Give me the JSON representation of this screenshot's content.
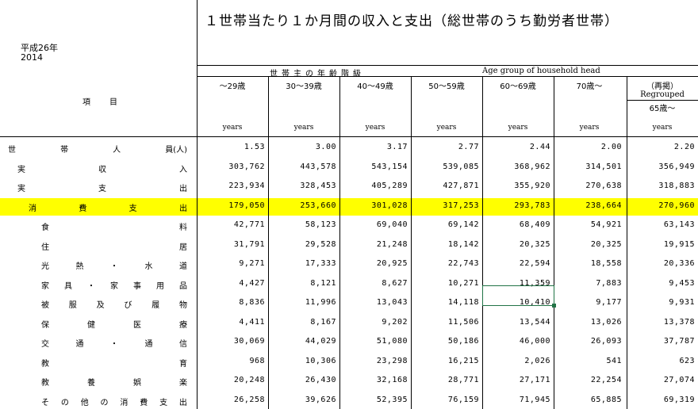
{
  "header": {
    "title": "１世帯当たり１か月間の収入と支出（総世帯のうち勤労者世帯）",
    "year_jp": "平成26年",
    "year_en": "2014",
    "group_jp": "世帯主の年齢階級",
    "group_en": "Age group of household head",
    "item_label": "項目"
  },
  "columns": [
    {
      "label": "～29歳",
      "unit": "years"
    },
    {
      "label": "30～39歳",
      "unit": "years"
    },
    {
      "label": "40～49歳",
      "unit": "years"
    },
    {
      "label": "50～59歳",
      "unit": "years"
    },
    {
      "label": "60～69歳",
      "unit": "years"
    },
    {
      "label": "70歳～",
      "unit": "years"
    }
  ],
  "regrouped": {
    "label_jp": "（再掲）",
    "label_en": "Regrouped",
    "label_age": "65歳～",
    "unit": "years"
  },
  "rows": [
    {
      "label": "世帯人員(人)",
      "indent": 0,
      "values": [
        "1.53",
        "3.00",
        "3.17",
        "2.77",
        "2.44",
        "2.00",
        "2.20"
      ]
    },
    {
      "label": "実収入",
      "indent": 1,
      "values": [
        "303,762",
        "443,578",
        "543,154",
        "539,085",
        "368,962",
        "314,501",
        "356,949"
      ]
    },
    {
      "label": "実支出",
      "indent": 1,
      "values": [
        "223,934",
        "328,453",
        "405,289",
        "427,871",
        "355,920",
        "270,638",
        "318,883"
      ]
    },
    {
      "label": "消費支出",
      "indent": 2,
      "values": [
        "179,050",
        "253,660",
        "301,028",
        "317,253",
        "293,783",
        "238,664",
        "270,960"
      ],
      "highlight": true
    },
    {
      "label": "食料",
      "indent": 3,
      "values": [
        "42,771",
        "58,123",
        "69,040",
        "69,142",
        "68,409",
        "54,921",
        "63,143"
      ]
    },
    {
      "label": "住居",
      "indent": 3,
      "values": [
        "31,791",
        "29,528",
        "21,248",
        "18,142",
        "20,325",
        "20,325",
        "19,915"
      ]
    },
    {
      "label": "光熱・水道",
      "indent": 3,
      "values": [
        "9,271",
        "17,333",
        "20,925",
        "22,743",
        "22,594",
        "18,558",
        "20,336"
      ]
    },
    {
      "label": "家具・家事用品",
      "indent": 3,
      "values": [
        "4,427",
        "8,121",
        "8,627",
        "10,271",
        "11,359",
        "7,883",
        "9,453"
      ]
    },
    {
      "label": "被服及び履物",
      "indent": 3,
      "values": [
        "8,836",
        "11,996",
        "13,043",
        "14,118",
        "10,410",
        "9,177",
        "9,931"
      ]
    },
    {
      "label": "保健医療",
      "indent": 3,
      "values": [
        "4,411",
        "8,167",
        "9,202",
        "11,506",
        "13,544",
        "13,026",
        "13,378"
      ]
    },
    {
      "label": "交通・通信",
      "indent": 3,
      "values": [
        "30,069",
        "44,029",
        "51,080",
        "50,186",
        "46,000",
        "26,093",
        "37,787"
      ]
    },
    {
      "label": "教育",
      "indent": 3,
      "values": [
        "968",
        "10,306",
        "23,298",
        "16,215",
        "2,026",
        "541",
        "623"
      ]
    },
    {
      "label": "教養娯楽",
      "indent": 3,
      "values": [
        "20,248",
        "26,430",
        "32,168",
        "28,771",
        "27,171",
        "22,254",
        "27,074"
      ]
    },
    {
      "label": "その他の消費支出",
      "indent": 3,
      "values": [
        "26,258",
        "39,626",
        "52,395",
        "76,159",
        "71,945",
        "65,885",
        "69,319"
      ]
    }
  ],
  "selected_cell": {
    "row": 8,
    "col": 4
  },
  "colors": {
    "highlight": "#ffff00",
    "selection": "#217346"
  }
}
